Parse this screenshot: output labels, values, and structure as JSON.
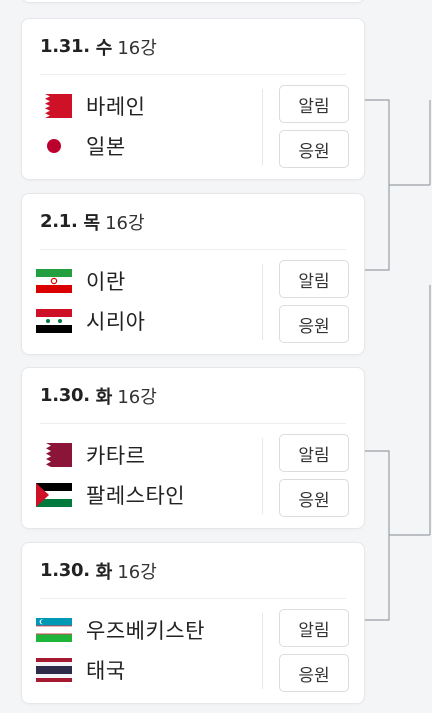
{
  "matches": [
    {
      "date": "1.31.",
      "day": "수",
      "round": "16강",
      "team1": {
        "name": "바레인",
        "flag": "bahrain-flag"
      },
      "team2": {
        "name": "일본",
        "flag": "japan-flag"
      },
      "alert_label": "알림",
      "cheer_label": "응원"
    },
    {
      "date": "2.1.",
      "day": "목",
      "round": "16강",
      "team1": {
        "name": "이란",
        "flag": "iran-flag"
      },
      "team2": {
        "name": "시리아",
        "flag": "syria-flag"
      },
      "alert_label": "알림",
      "cheer_label": "응원"
    },
    {
      "date": "1.30.",
      "day": "화",
      "round": "16강",
      "team1": {
        "name": "카타르",
        "flag": "qatar-flag"
      },
      "team2": {
        "name": "팔레스타인",
        "flag": "palestine-flag"
      },
      "alert_label": "알림",
      "cheer_label": "응원"
    },
    {
      "date": "1.30.",
      "day": "화",
      "round": "16강",
      "team1": {
        "name": "우즈베키스탄",
        "flag": "uzbekistan-flag"
      },
      "team2": {
        "name": "태국",
        "flag": "thailand-flag"
      },
      "alert_label": "알림",
      "cheer_label": "응원"
    }
  ],
  "colors": {
    "bracket_line": "#9aa0a6",
    "card_border": "#e6e7ea",
    "button_border": "#dadce0"
  }
}
